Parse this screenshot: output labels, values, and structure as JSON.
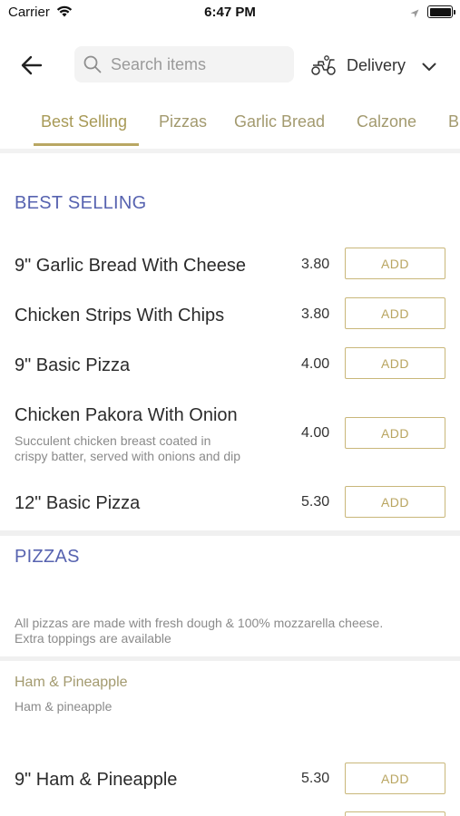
{
  "status_bar": {
    "carrier": "Carrier",
    "time": "6:47 PM"
  },
  "header": {
    "search_placeholder": "Search items",
    "delivery_label": "Delivery"
  },
  "tabs": [
    {
      "label": "Best Selling",
      "active": true
    },
    {
      "label": "Pizzas"
    },
    {
      "label": "Garlic Bread"
    },
    {
      "label": "Calzone"
    },
    {
      "label": "B"
    }
  ],
  "best_selling": {
    "title": "BEST SELLING",
    "items": [
      {
        "name": "9\" Garlic Bread With Cheese",
        "price": "3.80",
        "button": "ADD"
      },
      {
        "name": "Chicken Strips With Chips",
        "price": "3.80",
        "button": "ADD"
      },
      {
        "name": "9\" Basic Pizza",
        "price": "4.00",
        "button": "ADD"
      },
      {
        "name": "Chicken Pakora With Onion",
        "description_line1": "Succulent chicken breast coated in",
        "description_line2": "crispy batter, served with onions and dip",
        "price": "4.00",
        "button": "ADD"
      },
      {
        "name": "12\" Basic Pizza",
        "price": "5.30",
        "button": "ADD"
      }
    ]
  },
  "pizzas": {
    "title": "PIZZAS",
    "note_line1": "All pizzas are made with fresh dough & 100% mozzarella cheese.",
    "note_line2": "Extra toppings are available",
    "group": {
      "title": "Ham & Pineapple",
      "description": "Ham & pineapple",
      "items": [
        {
          "name": "9\" Ham & Pineapple",
          "price": "5.30",
          "button": "ADD"
        }
      ]
    }
  },
  "colors": {
    "accent_gold": "#b9a763",
    "section_blue": "#5763b0",
    "button_border": "#c9b77a"
  }
}
